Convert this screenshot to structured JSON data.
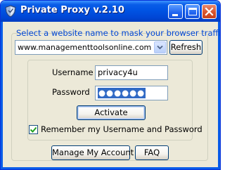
{
  "window": {
    "title": "Private Proxy v.2.10",
    "controls": [
      "minimize",
      "maximize",
      "close"
    ]
  },
  "prompt_text": "Select a website name to mask your browser traffic",
  "website_select": {
    "value": "www.managementtoolsonline.com"
  },
  "refresh_label": "Refresh",
  "login": {
    "username_label": "Username",
    "username_value": "privacy4u",
    "password_label": "Password",
    "password_value": "●●●●●●",
    "activate_label": "Activate"
  },
  "remember": {
    "checked": true,
    "label": "Remember my Username and Password"
  },
  "footer": {
    "manage_label": "Manage My Account",
    "faq_label": "FAQ"
  },
  "colors": {
    "titlebar": "#0054e3",
    "window_bg": "#ece9d8",
    "prompt_text": "#0046d5",
    "close_button": "#d9542c",
    "selection": "#316ac5"
  },
  "icons": {
    "app": "shield-icon",
    "minimize": "minimize-icon",
    "maximize": "maximize-icon",
    "close": "close-icon",
    "dropdown": "chevron-down-icon",
    "check": "checkmark-icon"
  }
}
